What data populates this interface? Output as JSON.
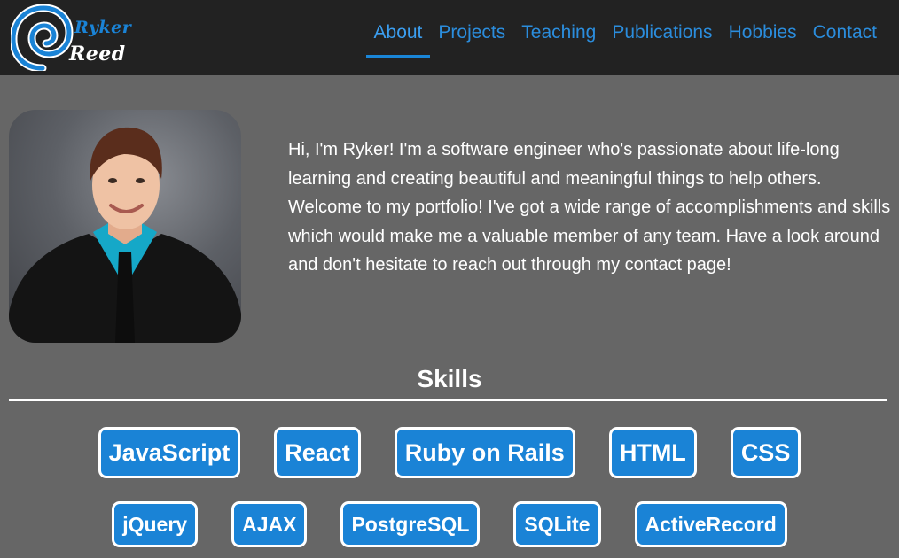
{
  "logo": {
    "first_name": "Ryker",
    "last_name": "Reed",
    "icon": "spiral-logo-icon",
    "accent_color": "#1a83d6"
  },
  "nav": {
    "items": [
      {
        "label": "About",
        "active": true
      },
      {
        "label": "Projects",
        "active": false
      },
      {
        "label": "Teaching",
        "active": false
      },
      {
        "label": "Publications",
        "active": false
      },
      {
        "label": "Hobbies",
        "active": false
      },
      {
        "label": "Contact",
        "active": false
      }
    ]
  },
  "intro": {
    "text": "Hi, I'm Ryker! I'm a software engineer who's passionate about life-long learning and creating beautiful and meaningful things to help others. Welcome to my portfolio! I've got a wide range of accomplishments and skills which would make me a valuable member of any team. Have a look around and don't hesitate to reach out through my contact page!"
  },
  "skills": {
    "heading": "Skills",
    "row1": [
      "JavaScript",
      "React",
      "Ruby on Rails",
      "HTML",
      "CSS"
    ],
    "row2": [
      "jQuery",
      "AJAX",
      "PostgreSQL",
      "SQLite",
      "ActiveRecord"
    ]
  },
  "colors": {
    "page_background": "#666666",
    "header_background": "#222222",
    "nav_link": "#2b8ddd",
    "skill_badge": "#1a83d6"
  }
}
